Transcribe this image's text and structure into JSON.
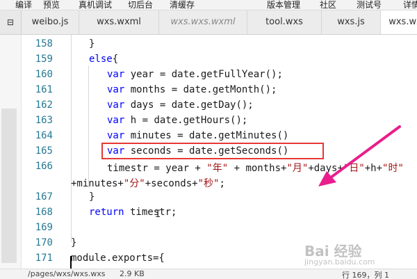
{
  "toolbar": {
    "items": [
      "编译",
      "预览",
      "真机调试",
      "切后台",
      "清缓存",
      "版本管理",
      "社区",
      "测试号",
      "详情"
    ]
  },
  "tabs": {
    "back_label": "⊟",
    "items": [
      {
        "label": "weibo.js"
      },
      {
        "label": "wxs.wxml"
      },
      {
        "label": "wxs.wxs.wxml"
      },
      {
        "label": "tool.wxs"
      },
      {
        "label": "wxs.js"
      },
      {
        "label": "wxs.wx"
      }
    ]
  },
  "editor": {
    "line_numbers": [
      "158",
      "159",
      "160",
      "161",
      "162",
      "163",
      "164",
      "165",
      "166",
      "",
      "167",
      "168",
      "169",
      "170",
      "171"
    ],
    "lines": [
      {
        "text": "}"
      },
      {
        "kw": "else",
        "text": "{"
      },
      {
        "kw": "var",
        "text": " year = date.getFullYear();"
      },
      {
        "kw": "var",
        "text": " months = date.getMonth();"
      },
      {
        "kw": "var",
        "text": " days = date.getDay();"
      },
      {
        "kw": "var",
        "text": " h = date.getHours();"
      },
      {
        "kw": "var",
        "text": " minutes = date.getMinutes()"
      },
      {
        "kw": "var",
        "text": " seconds = date.getSeconds()"
      },
      {
        "text": "timestr = year + ",
        "s1": "\"年\"",
        "t2": " + months+",
        "s2": "\"月\"",
        "t3": "+days+",
        "s3": "\"日\"",
        "t4": "+h+",
        "s4": "\"时\""
      },
      {
        "text": "+minutes+",
        "s1": "\"分\"",
        "t2": "+seconds+",
        "s2": "\"秒\"",
        "t3": ";"
      },
      {
        "text": "}"
      },
      {
        "kw": "return",
        "text": " timestr;"
      },
      {
        "text": ""
      },
      {
        "text": "}"
      },
      {
        "text": "module.exports={"
      }
    ]
  },
  "status": {
    "path": "/pages/wxs/wxs.wxs",
    "size": "2.9 KB",
    "position": "行 169，列 1"
  },
  "watermark": {
    "brand": "Bai 经验",
    "sub": "jingyan.baidu.com"
  }
}
